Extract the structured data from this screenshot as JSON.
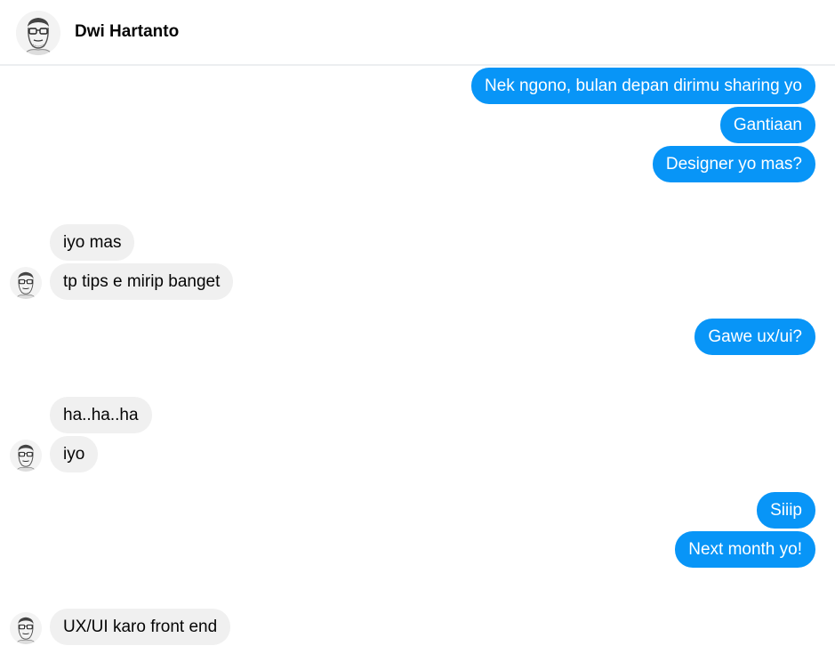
{
  "contact": {
    "name": "Dwi Hartanto"
  },
  "messages": [
    {
      "text": "Nek ngono, bulan depan dirimu sharing yo",
      "direction": "outgoing"
    },
    {
      "text": "Gantiaan",
      "direction": "outgoing"
    },
    {
      "text": "Designer yo mas?",
      "direction": "outgoing"
    },
    {
      "text": "iyo mas",
      "direction": "incoming"
    },
    {
      "text": "tp tips e mirip banget",
      "direction": "incoming"
    },
    {
      "text": "Gawe ux/ui?",
      "direction": "outgoing"
    },
    {
      "text": "ha..ha..ha",
      "direction": "incoming"
    },
    {
      "text": "iyo",
      "direction": "incoming"
    },
    {
      "text": "Siiip",
      "direction": "outgoing"
    },
    {
      "text": "Next month yo!",
      "direction": "outgoing"
    },
    {
      "text": "UX/UI karo front end",
      "direction": "incoming"
    }
  ],
  "colors": {
    "outgoing_bubble": "#0895f7",
    "incoming_bubble": "#f0f0f0",
    "outgoing_text": "#ffffff",
    "incoming_text": "#050505"
  }
}
